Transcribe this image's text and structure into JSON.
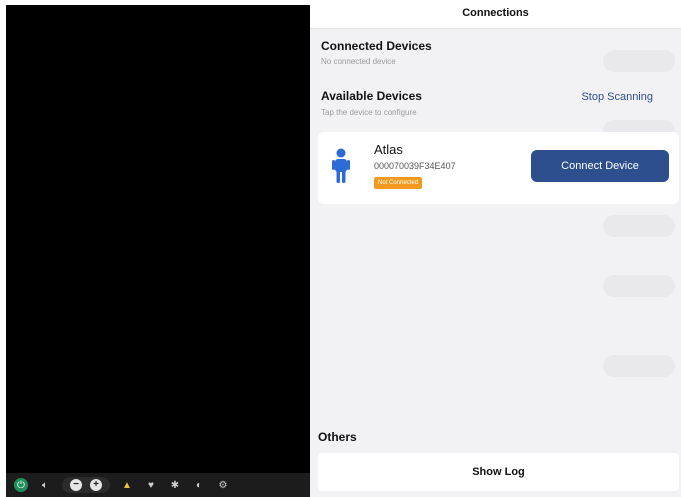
{
  "header": {
    "title": "Connections"
  },
  "connected": {
    "title": "Connected Devices",
    "subtitle": "No connected device"
  },
  "available": {
    "title": "Available Devices",
    "subtitle": "Tap the device to configure",
    "stop_label": "Stop Scanning"
  },
  "device": {
    "name": "Atlas",
    "id": "000070039F34E407",
    "status": "Not Connected",
    "connect_label": "Connect Device"
  },
  "others": {
    "title": "Others",
    "show_log_label": "Show Log"
  },
  "colors": {
    "accent": "#2d4f8e",
    "status_orange": "#f29a1f",
    "person_icon": "#2d6bd6",
    "power_green": "#1e8f5a"
  },
  "icons": {
    "power": "power-icon",
    "volume": "volume-icon",
    "minus": "minus-icon",
    "plus": "plus-icon",
    "bell": "bell-icon",
    "heart": "heart-icon",
    "snowflake": "snowflake-icon",
    "contrast": "contrast-icon",
    "gear": "gear-icon",
    "person": "person-icon"
  }
}
